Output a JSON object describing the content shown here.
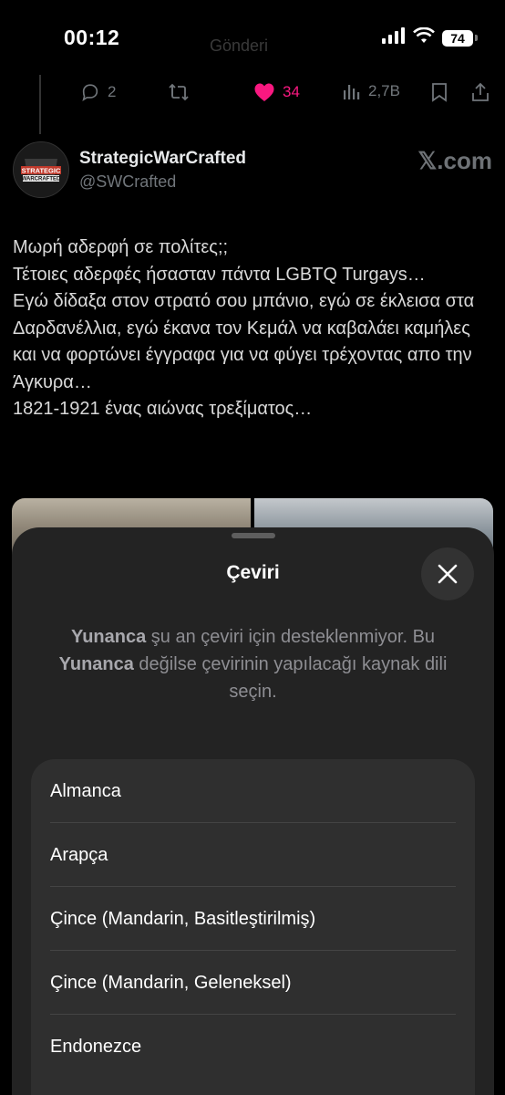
{
  "status_bar": {
    "time": "00:12",
    "battery": "74",
    "faded_title": "Gönderi"
  },
  "actions": {
    "replies": "2",
    "likes": "34",
    "views": "2,7B"
  },
  "tweet": {
    "display_name": "StrategicWarCrafted",
    "handle": "@SWCrafted",
    "watermark": "𝕏.com",
    "avatar_text": {
      "line1": "STRATEGIC",
      "line2": "WARCRAFTED"
    },
    "text": "Μωρή αδερφή σε πολίτες;;\nΤέτοιες αδερφές ήσασταν πάντα LGBTQ Turgays…\nΕγώ δίδαξα στον στρατό σου μπάνιο, εγώ σε έκλεισα στα Δαρδανέλλια, εγώ έκανα τον Κεμάλ να καβαλάει καμήλες και να φορτώνει έγγραφα για να φύγει τρέχοντας απο την Άγκυρα…\n1821-1921 ένας αιώνας τρεξίματος…"
  },
  "sheet": {
    "title": "Çeviri",
    "message_part1": "Yunanca",
    "message_part2": " şu an çeviri için desteklenmiyor. Bu ",
    "message_part3": "Yunanca",
    "message_part4": " değilse çevirinin yapılacağı kaynak dili seçin.",
    "languages": [
      "Almanca",
      "Arapça",
      "Çince (Mandarin, Basitleştirilmiş)",
      "Çince (Mandarin, Geleneksel)",
      "Endonezce"
    ]
  },
  "colors": {
    "like": "#f91880",
    "muted": "#71767b",
    "sheet_bg": "#232323",
    "list_bg": "#2f2f2f"
  }
}
